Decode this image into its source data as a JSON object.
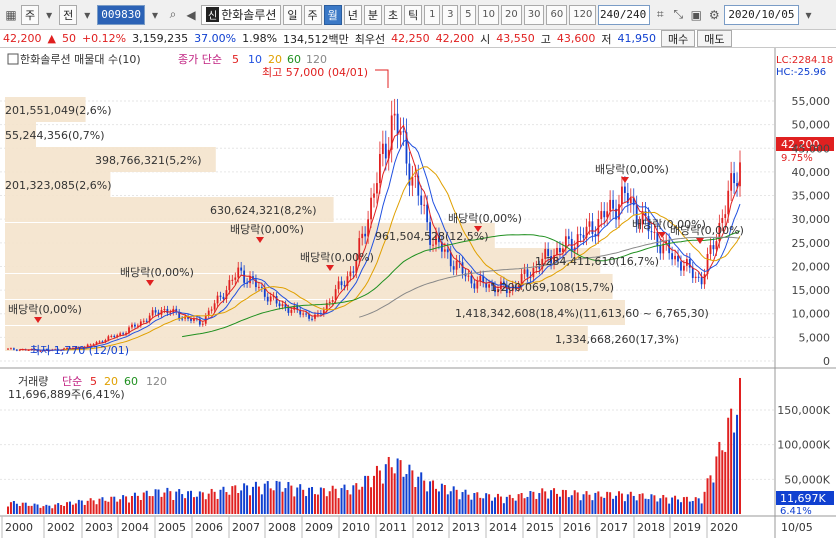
{
  "toolbar": {
    "market": "주",
    "prev": "전",
    "code": "009830",
    "name": "한화솔루션",
    "sin": "신",
    "periods": [
      "일",
      "주",
      "월",
      "년"
    ],
    "active_period": "월",
    "more_periods": [
      "분",
      "초",
      "틱"
    ],
    "intervals": [
      "1",
      "3",
      "5",
      "10",
      "20",
      "30",
      "60",
      "120"
    ],
    "count": "240",
    "count_total": "/240",
    "date": "2020/10/05"
  },
  "quote": {
    "price": "42,200",
    "arrow": "▲",
    "change": "50",
    "pct": "+0.12%",
    "volume": "3,159,235",
    "strength": "37.00%",
    "turnover": "1.98%",
    "amount": "134,512백만",
    "ask_label": "최우선",
    "ask": "42,250",
    "bid": "42,200",
    "open_label": "시",
    "open": "43,550",
    "high_label": "고",
    "high": "43,600",
    "low_label": "저",
    "low": "41,950",
    "buy_button": "매수",
    "sell_button": "매도"
  },
  "chart": {
    "price_title": "한화솔루션 매물대 수(10)",
    "ma_label": "종가 단순",
    "ma_periods": [
      "5",
      "10",
      "20",
      "60",
      "120"
    ],
    "ma_colors": [
      "#e02020",
      "#2050e0",
      "#e0a000",
      "#209020",
      "#888888"
    ],
    "lc": "LC:2284.18",
    "hc": "HC:-25.96",
    "current_price": "42,200",
    "current_pct": "9.75%",
    "high_note": "최고 57,000 (04/01)",
    "low_note": "최저 1,770 (12/01)",
    "dividend": "배당락(0,00%)",
    "price_ticks": [
      "55,000",
      "50,000",
      "45,000",
      "40,000",
      "35,000",
      "30,000",
      "25,000",
      "20,000",
      "15,000",
      "10,000",
      "5,000",
      "0"
    ],
    "volume_profile": [
      {
        "text": "201,551,049(2,6%)"
      },
      {
        "text": "55,244,356(0,7%)"
      },
      {
        "text": "398,766,321(5,2%)"
      },
      {
        "text": "201,323,085(2,6%)"
      },
      {
        "text": "630,624,321(8,2%)"
      },
      {
        "text": "961,504,528(12,5%)"
      },
      {
        "text": "1,284,411,610(16,7%)"
      },
      {
        "text": "1,200,069,108(15,7%)"
      },
      {
        "text": "1,418,342,608(18,4%)(11,613,60 ~ 6,765,30)"
      },
      {
        "text": "1,334,668,260(17,3%)"
      }
    ],
    "volume_title": "거래량",
    "volume_ma_label": "단순",
    "volume_ma_periods": [
      "5",
      "20",
      "60",
      "120"
    ],
    "volume_value": "11,696,889주(6,41%)",
    "volume_ticks": [
      "150,000K",
      "100,000K",
      "50,000K"
    ],
    "volume_current": "11,697K",
    "volume_pct": "6.41%",
    "x_labels": [
      "2000",
      "2002",
      "2003",
      "2004",
      "2005",
      "2006",
      "2007",
      "2008",
      "2009",
      "2010",
      "2011",
      "2012",
      "2013",
      "2014",
      "2015",
      "2016",
      "2017",
      "2018",
      "2019",
      "2020"
    ],
    "x_end": "10/05"
  },
  "chart_data": {
    "type": "candlestick",
    "series": [
      {
        "name": "한화솔루션",
        "x": [
          "2000",
          "2002",
          "2003",
          "2004",
          "2005",
          "2006",
          "2007",
          "2008",
          "2009",
          "2010",
          "2011",
          "2012",
          "2013",
          "2014",
          "2015",
          "2016",
          "2017",
          "2018",
          "2019",
          "2020"
        ],
        "values": [
          2500,
          2200,
          3000,
          6000,
          11000,
          8000,
          19000,
          12000,
          9000,
          20000,
          52000,
          26000,
          17000,
          15000,
          22000,
          27000,
          35000,
          24000,
          17000,
          42200
        ]
      },
      {
        "name": "거래량",
        "x": [
          "2000",
          "2002",
          "2003",
          "2004",
          "2005",
          "2006",
          "2007",
          "2008",
          "2009",
          "2010",
          "2011",
          "2012",
          "2013",
          "2014",
          "2015",
          "2016",
          "2017",
          "2018",
          "2019",
          "2020"
        ],
        "values": [
          18000,
          12000,
          20000,
          25000,
          35000,
          30000,
          40000,
          45000,
          35000,
          40000,
          80000,
          45000,
          30000,
          25000,
          35000,
          30000,
          30000,
          25000,
          22000,
          180000
        ]
      }
    ],
    "ylim": [
      0,
      57000
    ],
    "volume_ylim": [
      0,
      180000
    ]
  }
}
